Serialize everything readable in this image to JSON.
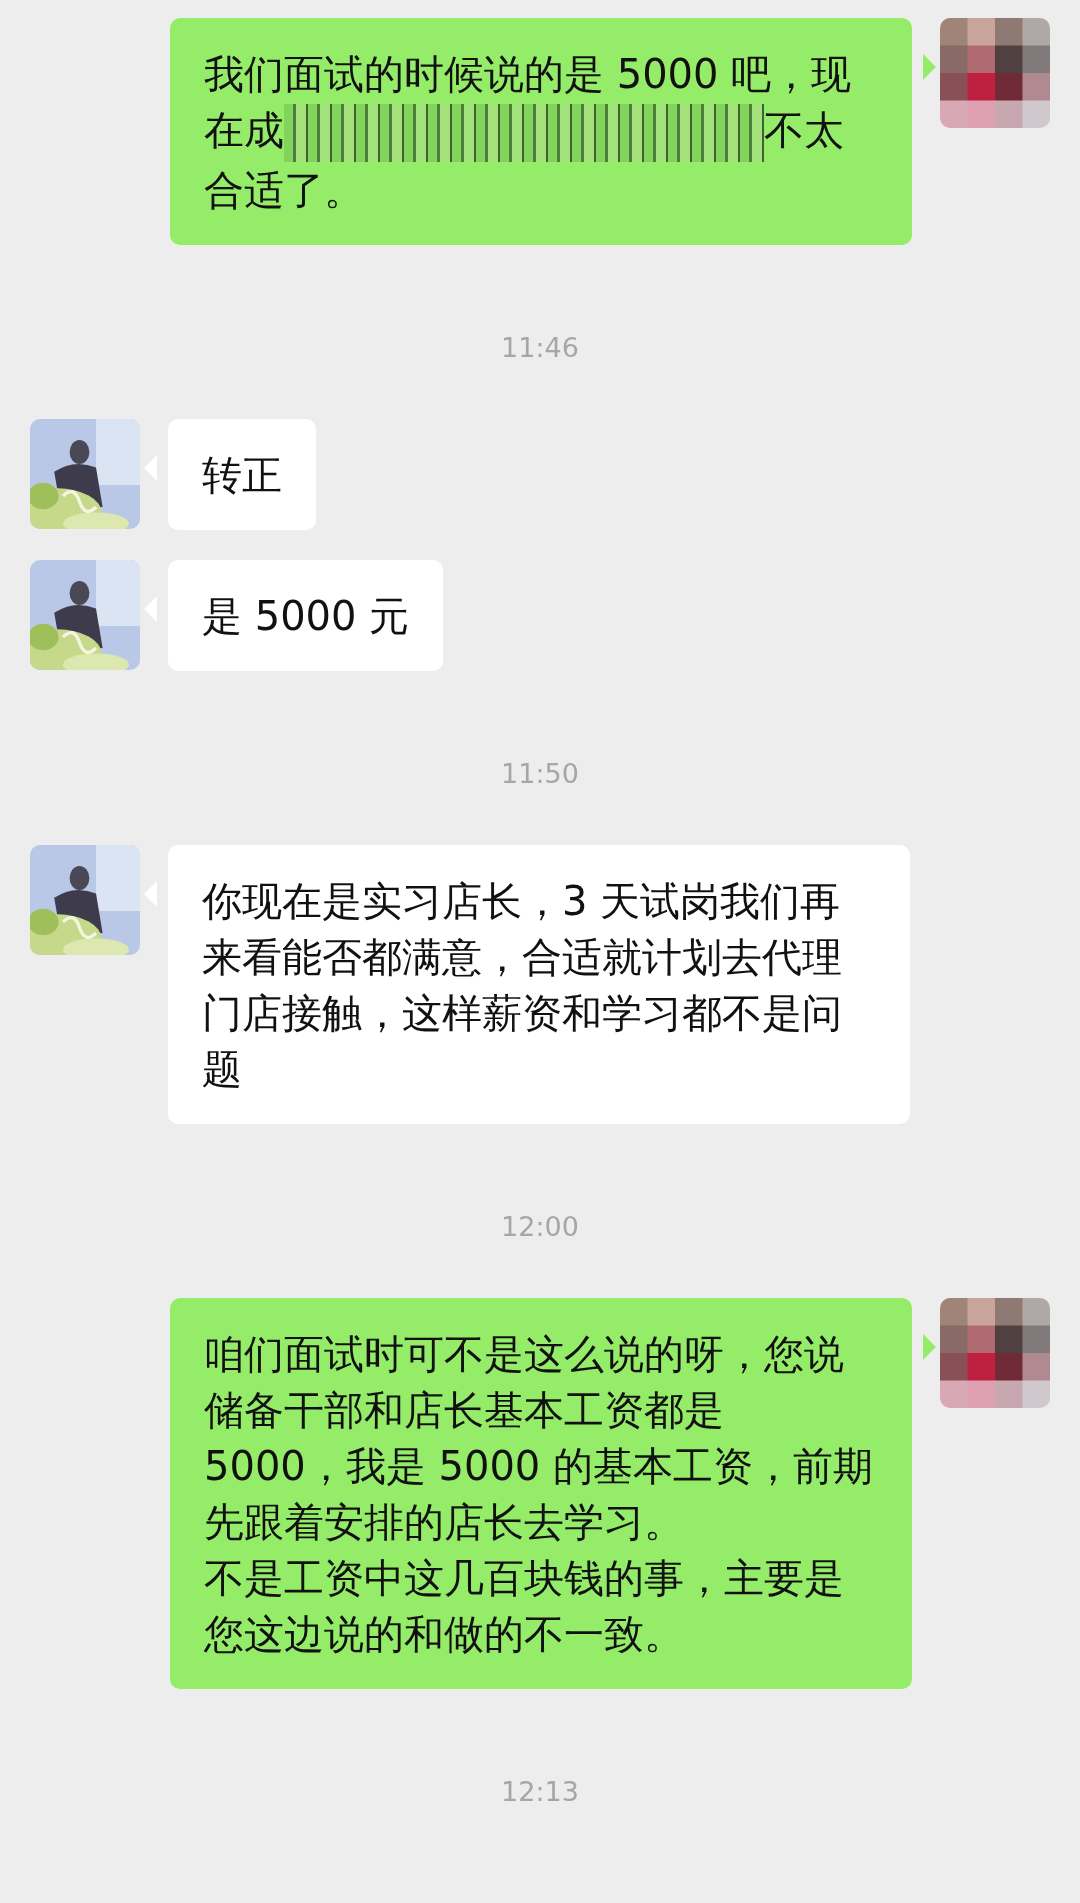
{
  "items": [
    {
      "kind": "sent_message",
      "avatar": {
        "kind": "picture"
      },
      "paragraphs": [
        [
          {
            "kind": "text",
            "text": "我们面试的时候说的是 5000 吧，现在成"
          },
          {
            "kind": "blur"
          },
          {
            "kind": "text",
            "text": "不太合适了。"
          }
        ]
      ]
    },
    {
      "kind": "time",
      "text": "11:46"
    },
    {
      "kind": "received_message",
      "avatar": {
        "kind": "picture"
      },
      "paragraphs": [
        [
          {
            "kind": "text",
            "text": "转正"
          }
        ]
      ]
    },
    {
      "kind": "received_message",
      "avatar": {
        "kind": "picture"
      },
      "paragraphs": [
        [
          {
            "kind": "text",
            "text": "是 5000 元"
          }
        ]
      ]
    },
    {
      "kind": "time",
      "text": "11:50"
    },
    {
      "kind": "received_message",
      "avatar": {
        "kind": "picture"
      },
      "paragraphs": [
        [
          {
            "kind": "text",
            "text": "你现在是实习店长，3 天试岗我们再来看能否都满意，合适就计划去代理门店接触，这样薪资和学习都不是问题"
          }
        ]
      ]
    },
    {
      "kind": "time",
      "text": "12:00"
    },
    {
      "kind": "sent_message",
      "avatar": {
        "kind": "picture"
      },
      "paragraphs": [
        [
          {
            "kind": "text",
            "text": "咱们面试时可不是这么说的呀，您说储备干部和店长基本工资都是 5000，我是 5000 的基本工资，前期先跟着安排的店长去学习。"
          }
        ],
        [
          {
            "kind": "text",
            "text": "不是工资中这几百块钱的事，主要是您这边说的和做的不一致。"
          }
        ]
      ]
    },
    {
      "kind": "time",
      "text": "12:13"
    }
  ]
}
